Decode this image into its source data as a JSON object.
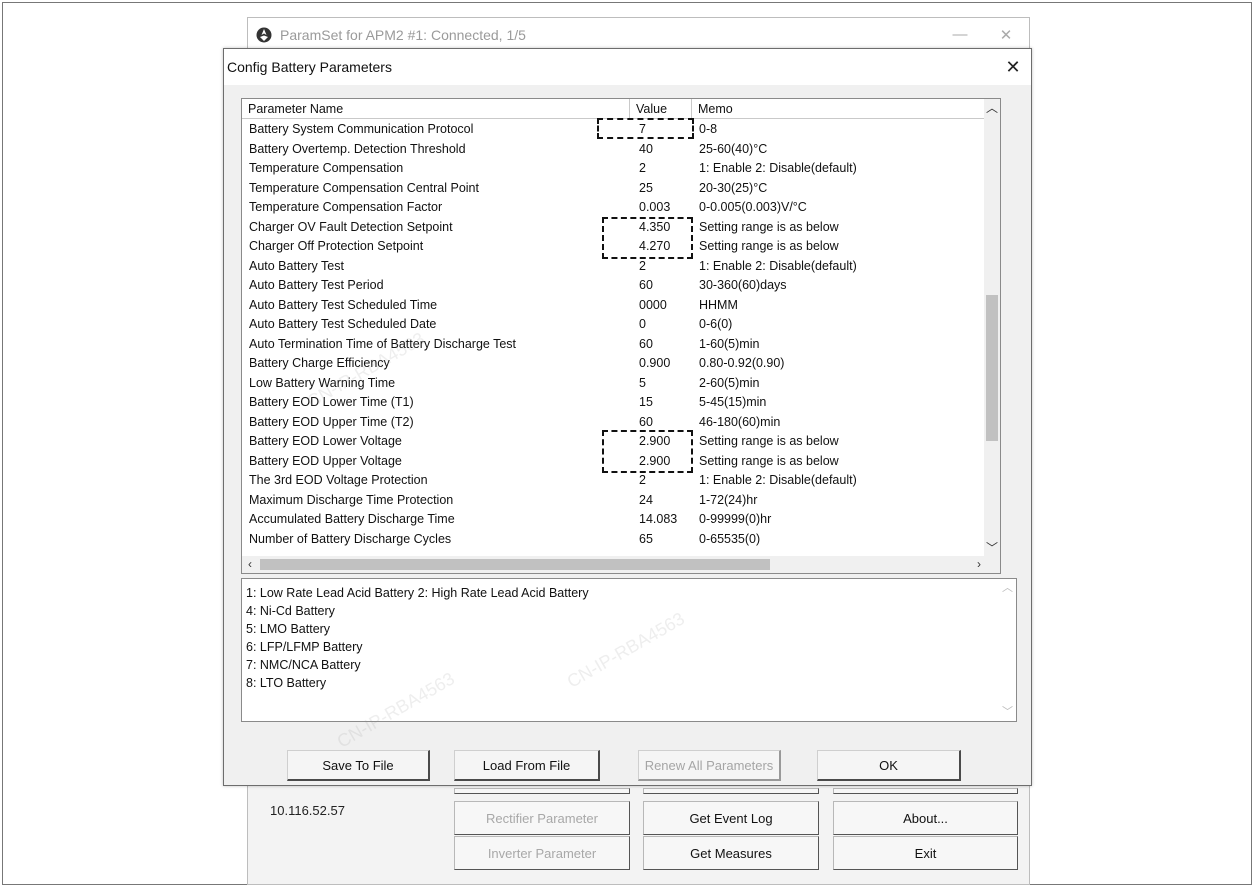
{
  "main_window": {
    "title": "ParamSet for  APM2 #1: Connected, 1/5",
    "minimize": "—",
    "close": "✕",
    "ip_address": "10.116.52.57",
    "buttons": {
      "rectifier": "Rectifier Parameter",
      "event_log": "Get Event Log",
      "about": "About...",
      "inverter": "Inverter Parameter",
      "measures": "Get Measures",
      "exit": "Exit"
    }
  },
  "dialog": {
    "title": "Config Battery Parameters",
    "close": "✕",
    "table": {
      "headers": {
        "name": "Parameter Name",
        "value": "Value",
        "memo": "Memo"
      },
      "rows": [
        {
          "name": "Battery System Communication Protocol",
          "value": "7",
          "memo": "0-8"
        },
        {
          "name": "Battery Overtemp. Detection Threshold",
          "value": "40",
          "memo": "25-60(40)°C"
        },
        {
          "name": "Temperature Compensation",
          "value": "2",
          "memo": "1: Enable 2: Disable(default)"
        },
        {
          "name": "Temperature Compensation Central Point",
          "value": "25",
          "memo": "20-30(25)°C"
        },
        {
          "name": "Temperature Compensation Factor",
          "value": "0.003",
          "memo": "0-0.005(0.003)V/°C"
        },
        {
          "name": "Charger OV Fault Detection Setpoint",
          "value": "4.350",
          "memo": "Setting range is as below"
        },
        {
          "name": "Charger Off Protection Setpoint",
          "value": "4.270",
          "memo": "Setting range is as below"
        },
        {
          "name": "Auto Battery Test",
          "value": "2",
          "memo": "1: Enable 2: Disable(default)"
        },
        {
          "name": "Auto Battery Test Period",
          "value": "60",
          "memo": "30-360(60)days"
        },
        {
          "name": "Auto Battery Test Scheduled Time",
          "value": "0000",
          "memo": "HHMM"
        },
        {
          "name": "Auto Battery Test Scheduled Date",
          "value": "0",
          "memo": "0-6(0)"
        },
        {
          "name": "Auto Termination Time of Battery Discharge Test",
          "value": "60",
          "memo": "1-60(5)min"
        },
        {
          "name": "Battery Charge Efficiency",
          "value": "0.900",
          "memo": "0.80-0.92(0.90)"
        },
        {
          "name": "Low Battery Warning Time",
          "value": "5",
          "memo": "2-60(5)min"
        },
        {
          "name": "Battery EOD Lower Time (T1)",
          "value": "15",
          "memo": "5-45(15)min"
        },
        {
          "name": "Battery EOD Upper Time (T2)",
          "value": "60",
          "memo": "46-180(60)min"
        },
        {
          "name": "Battery EOD Lower Voltage",
          "value": "2.900",
          "memo": "Setting range is as below"
        },
        {
          "name": "Battery EOD Upper Voltage",
          "value": "2.900",
          "memo": "Setting range is as below"
        },
        {
          "name": "The 3rd EOD Voltage Protection",
          "value": "2",
          "memo": "1: Enable 2: Disable(default)"
        },
        {
          "name": "Maximum Discharge Time Protection",
          "value": "24",
          "memo": "1-72(24)hr"
        },
        {
          "name": "Accumulated Battery Discharge Time",
          "value": "14.083",
          "memo": "0-99999(0)hr"
        },
        {
          "name": "Number of Battery Discharge Cycles",
          "value": "65",
          "memo": "0-65535(0)"
        }
      ]
    },
    "description_lines": [
      "1: Low Rate Lead Acid Battery 2: High Rate Lead Acid Battery",
      "4: Ni-Cd Battery",
      "5: LMO Battery",
      "6: LFP/LFMP Battery",
      "7: NMC/NCA Battery",
      "8: LTO Battery"
    ],
    "buttons": {
      "save": "Save To File",
      "load": "Load From File",
      "renew": "Renew All Parameters",
      "ok": "OK"
    }
  },
  "watermark": "CN-IP-RBA4563"
}
